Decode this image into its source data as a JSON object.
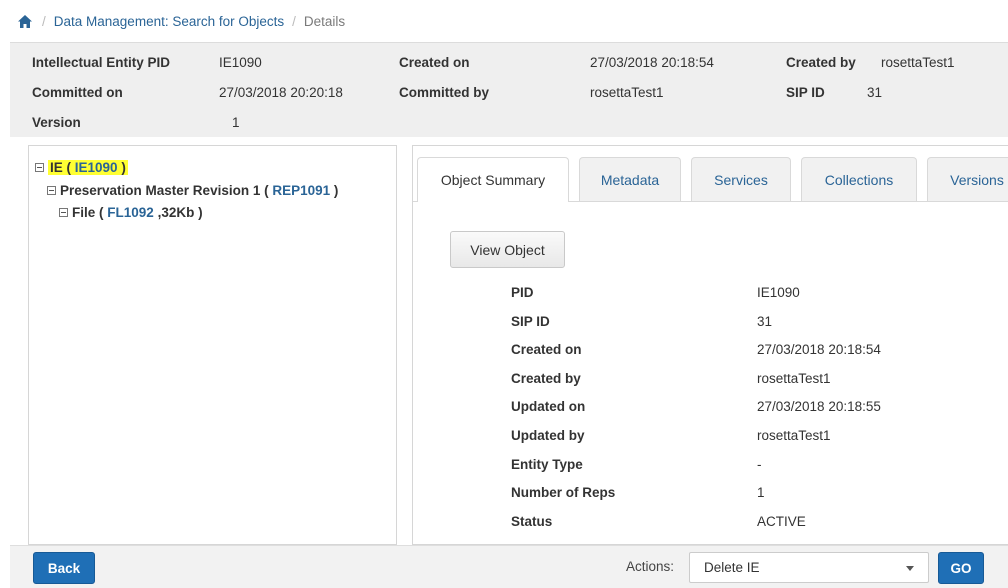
{
  "breadcrumb": {
    "items": [
      "Data Management: Search for Objects",
      "Details"
    ],
    "separator": "/"
  },
  "info": {
    "row1": {
      "l1": "Intellectual Entity PID",
      "v1": "IE1090",
      "l2": "Created on",
      "v2": "27/03/2018 20:18:54",
      "l3": "Created by",
      "v3": "rosettaTest1"
    },
    "row2": {
      "l1": "Committed on",
      "v1": "27/03/2018 20:20:18",
      "l2": "Committed by",
      "v2": "rosettaTest1",
      "l3": "SIP ID",
      "v3": "31"
    },
    "row3": {
      "l1": "Version",
      "v1": "1"
    }
  },
  "tree": {
    "ie": {
      "prefix": "IE (",
      "id": "IE1090",
      "suffix": ")"
    },
    "rep": {
      "prefix": "Preservation Master Revision 1 (",
      "id": "REP1091",
      "suffix": ")"
    },
    "file": {
      "prefix": "File (",
      "id": "FL1092",
      "suffix": ",32Kb )"
    }
  },
  "tabs": [
    "Object Summary",
    "Metadata",
    "Services",
    "Collections",
    "Versions"
  ],
  "view_object_label": "View Object",
  "summary": [
    {
      "k": "PID",
      "v": "IE1090"
    },
    {
      "k": "SIP ID",
      "v": "31"
    },
    {
      "k": "Created on",
      "v": "27/03/2018 20:18:54"
    },
    {
      "k": "Created by",
      "v": "rosettaTest1"
    },
    {
      "k": "Updated on",
      "v": "27/03/2018 20:18:55"
    },
    {
      "k": "Updated by",
      "v": "rosettaTest1"
    },
    {
      "k": "Entity Type",
      "v": "-"
    },
    {
      "k": "Number of Reps",
      "v": "1"
    },
    {
      "k": "Status",
      "v": "ACTIVE"
    }
  ],
  "footer": {
    "back_label": "Back",
    "actions_label": "Actions:",
    "selected_action": "Delete IE",
    "go_label": "GO"
  },
  "colors": {
    "link": "#2a6496",
    "primary": "#1f6fb6",
    "highlight": "#ffff33"
  },
  "icons": {
    "home": "home-icon",
    "tree_toggle": "minus-box-icon",
    "dropdown": "caret-down-icon"
  }
}
